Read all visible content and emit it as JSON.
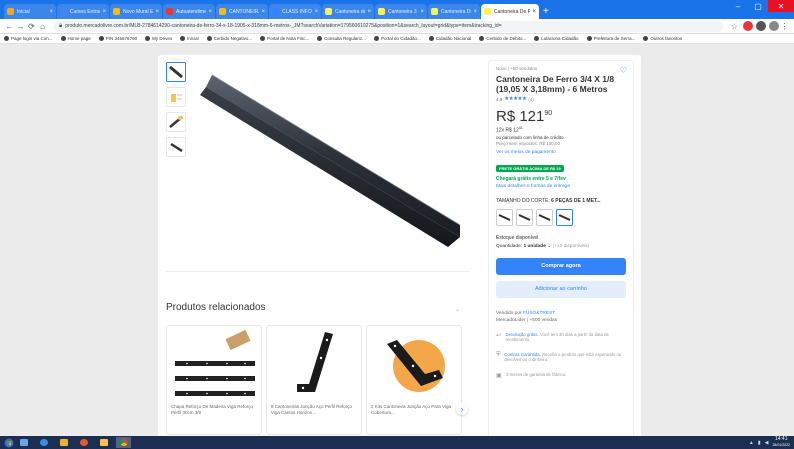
{
  "browser": {
    "tabs": [
      {
        "title": "Inicial",
        "fav": "#f5a623",
        "active": false
      },
      {
        "title": "Cursos Entrada Li...",
        "fav": "#4285f4",
        "active": false
      },
      {
        "title": "Novo Mural Escol...",
        "fav": "#fbbc05",
        "active": false
      },
      {
        "title": "Autoatendimento",
        "fav": "#e53935",
        "active": false
      },
      {
        "title": "CANTONEIRA DE F...",
        "fav": "#fbbc05",
        "active": false
      },
      {
        "title": "CLASS INFORM...",
        "fav": "#3483fa",
        "active": false
      },
      {
        "title": "Cantoneira de Fe...",
        "fav": "#fff159",
        "active": false
      },
      {
        "title": "Cantoneira 3 Fu...",
        "fav": "#fff159",
        "active": false
      },
      {
        "title": "Cantoneira De Fer...",
        "fav": "#fff159",
        "active": false
      },
      {
        "title": "Cantoneira De Fer...",
        "fav": "#fff159",
        "active": true
      }
    ],
    "url": "produto.mercadolivre.com.br/MLB-2784614290-cantoneira-de-ferro-34-x-18-1905-x-318mm-6-metros-_JM?searchVariation=179560610275&position=1&search_layout=grid&type=item&tracking_id=",
    "bookmarks": [
      "Page login via Con...",
      "Home page",
      "PIN 345678790",
      "My Drives",
      "Inicial",
      "Cerbido Negativo...",
      "Portal de Nota Fisc...",
      "Consulta Regulariz...",
      "Portal do Cidadão...",
      "Cidadão Nacional",
      "Cerbido de Débito...",
      "Lulaciona Cidadão",
      "Prefeitura de Serra...",
      "Outros favoritos"
    ]
  },
  "gallery": {
    "thumbs": [
      "angle-bar-thumb",
      "dimension-diagram-thumb",
      "angle-bar-yellow-thumb",
      "angle-bar-small-thumb"
    ]
  },
  "related": {
    "title": "Produtos relacionados",
    "items": [
      {
        "caption": "Chapa Reforço De Madeira Viga Reforço Perfil 30cm 3/8"
      },
      {
        "caption": "8 Cantoneiras Junção Aço Perfil Reforço Viga Cantos Horizon..."
      },
      {
        "caption": "2 Kits Cantoneira Junção Aço Para Viga Cobertura..."
      }
    ]
  },
  "product": {
    "condition": "Novo  |  +50 vendidos",
    "title": "Cantoneira De Ferro 3/4 X 1/8 (19,05 X 3,18mm) - 6 Metros",
    "rating_value": "4.9",
    "stars": "★★★★★",
    "rating_count": "(4)",
    "price_int": "R$ 121",
    "price_cents": "90",
    "installments": "12x R$ 12",
    "installments_cents": "41",
    "installment_note": "ou parcelado com linha de crédito",
    "price_note": "Preço sem impostos: R$ 100,00",
    "payment_link": "Ver os meios de pagamento",
    "ship_badge": "FRETE GRÁTIS ACIMA DE R$ 19",
    "ship_free": "Chegará grátis entre 5 e 7/fev",
    "ship_link": "Mais detalhes e formas de entrega",
    "size_label": "TAMANHO DO CORTE: ",
    "size_value": "6 PEÇAS DE 1 MET...",
    "stock": "Estoque disponível",
    "qty_label": "Quantidade: ",
    "qty_value": "1 unidade",
    "qty_more": "(+10 disponíveis)",
    "buy_label": "Comprar agora",
    "cart_label": "Adicionar ao carrinho",
    "seller_label": "Vendido por ",
    "seller_name": "FUSO&TREST",
    "seller_stats": "MercadoLíder  |  +500 vendas",
    "perks": [
      {
        "icon": "return-icon",
        "link": "Devolução grátis.",
        "text": " Você tem 30 dias a partir da data de recebimento."
      },
      {
        "icon": "shield-icon",
        "link": "Compra Garantida.",
        "text": " Receba o produto que está esperando ou devolvemos o dinheiro."
      },
      {
        "icon": "warranty-icon",
        "link": "",
        "text": "3 meses de garantia de fábrica."
      }
    ]
  },
  "taskbar": {
    "time": "14:41",
    "date": "28/01/2022",
    "apps": [
      "explorer",
      "ie",
      "store",
      "media",
      "folder",
      "chrome"
    ]
  },
  "colors": {
    "accent": "#3483fa",
    "green": "#00a650",
    "chrome_blue": "#1a73e8",
    "taskbar": "#1c2e52"
  }
}
